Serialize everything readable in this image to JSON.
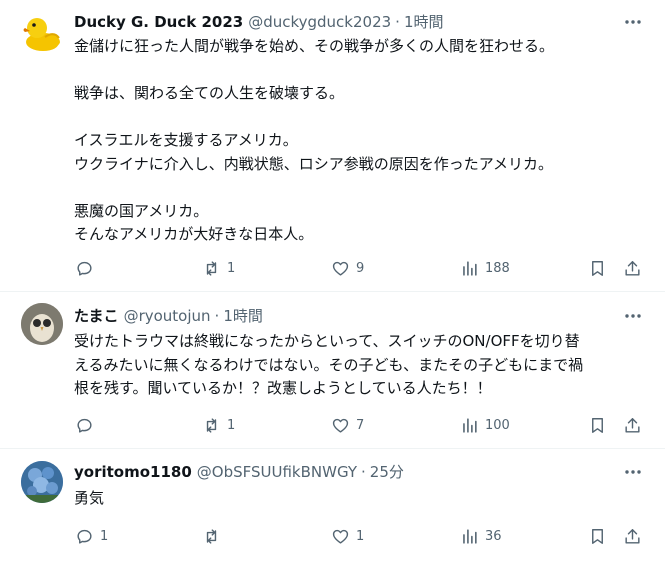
{
  "posts": [
    {
      "name": "Ducky G. Duck 2023",
      "handle": "@duckygduck2023",
      "dot": "·",
      "time": "1時間",
      "lines": [
        "金儲けに狂った人間が戦争を始め、その戦争が多くの人間を狂わせる。",
        "",
        "戦争は、関わる全ての人生を破壊する。",
        "",
        "イスラエルを支援するアメリカ。",
        "ウクライナに介入し、内戦状態、ロシア参戦の原因を作ったアメリカ。",
        "",
        "悪魔の国アメリカ。",
        "そんなアメリカが大好きな日本人。"
      ],
      "replies": "",
      "reposts": "1",
      "likes": "9",
      "views": "188"
    },
    {
      "name": "たまこ",
      "handle": "@ryoutojun",
      "dot": "·",
      "time": "1時間",
      "lines": [
        "受けたトラウマは終戦になったからといって、スイッチのON/OFFを切り替",
        "えるみたいに無くなるわけではない。その子ども、またその子どもにまで禍",
        "根を残す。聞いているか！？改憲しようとしている人たち！！"
      ],
      "replies": "",
      "reposts": "1",
      "likes": "7",
      "views": "100"
    },
    {
      "name": "yoritomo1180",
      "handle": "@ObSFSUUfikBNWGY",
      "dot": "·",
      "time": "25分",
      "lines": [
        "勇気"
      ],
      "replies": "1",
      "reposts": "",
      "likes": "1",
      "views": "36"
    }
  ],
  "icons": {
    "reply": "reply-icon",
    "repost": "repost-icon",
    "like": "heart-icon",
    "views": "views-icon",
    "bookmark": "bookmark-icon",
    "share": "share-icon",
    "more": "more-icon"
  },
  "colors": {
    "text": "#0f1419",
    "secondary": "#536471",
    "border": "#eff3f4"
  }
}
